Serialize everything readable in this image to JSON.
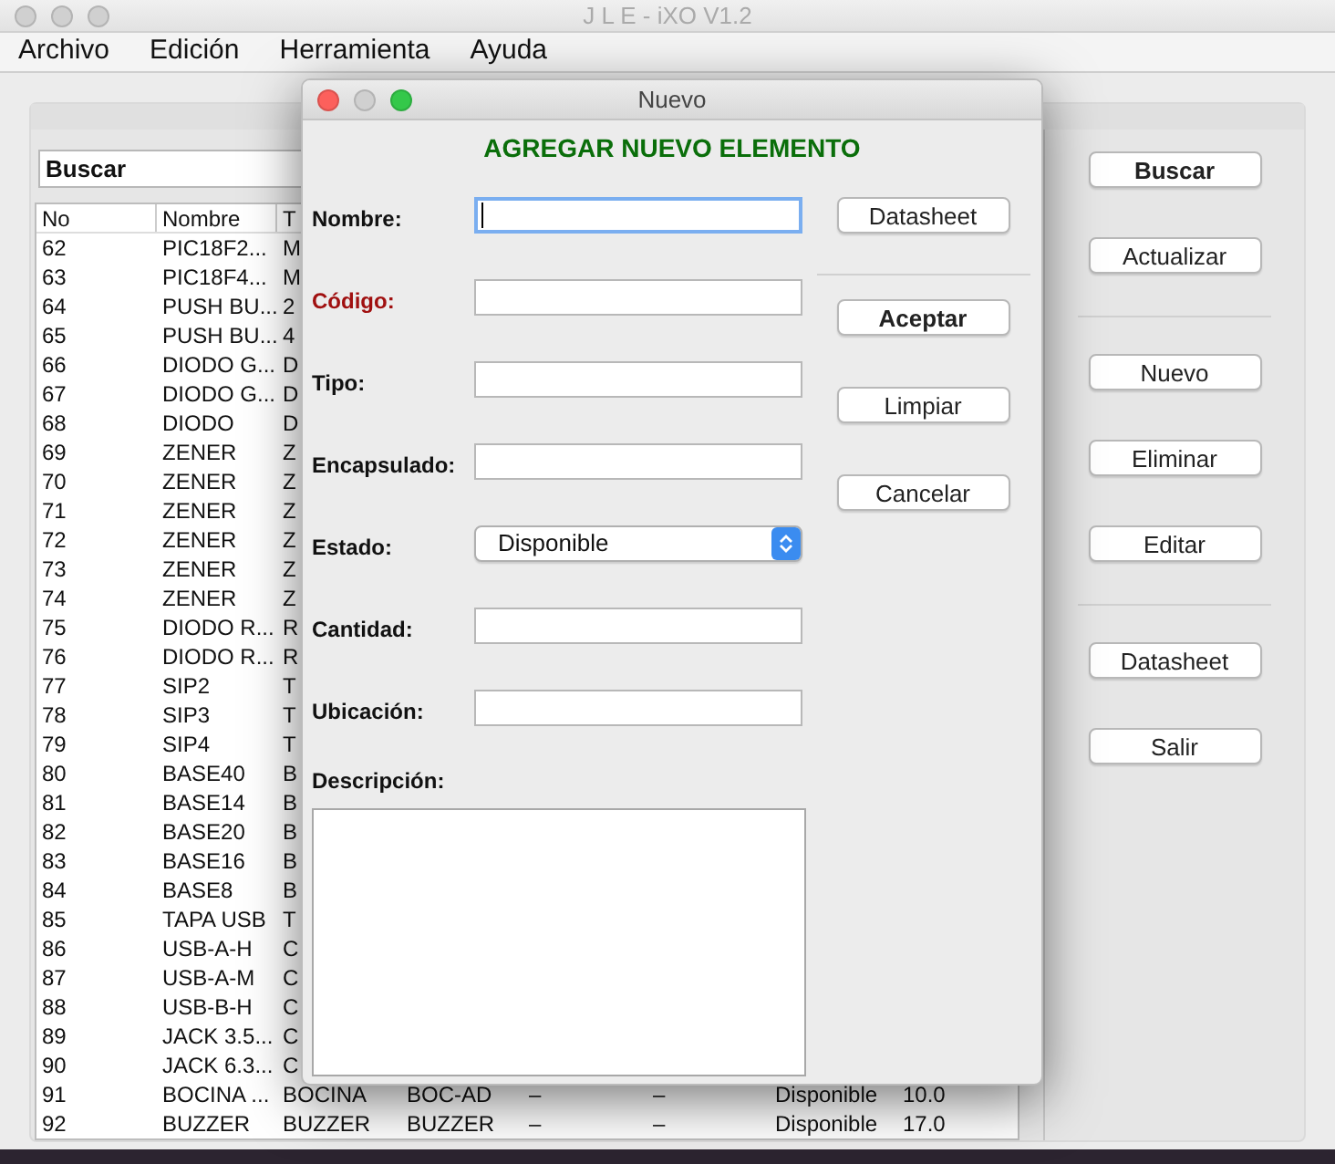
{
  "window": {
    "title": "J L E - iXO V1.2"
  },
  "menu": [
    "Archivo",
    "Edición",
    "Herramienta",
    "Ayuda"
  ],
  "search": {
    "value": "Buscar"
  },
  "table": {
    "columns": [
      "No",
      "Nombre",
      "T"
    ],
    "rows": [
      {
        "cells": [
          "62",
          "PIC18F2...",
          "M"
        ]
      },
      {
        "cells": [
          "63",
          "PIC18F4...",
          "M"
        ]
      },
      {
        "cells": [
          "64",
          "PUSH BU...",
          "2"
        ]
      },
      {
        "cells": [
          "65",
          "PUSH BU...",
          "4"
        ]
      },
      {
        "cells": [
          "66",
          "DIODO G...",
          "D"
        ]
      },
      {
        "cells": [
          "67",
          "DIODO G...",
          "D"
        ]
      },
      {
        "cells": [
          "68",
          "DIODO",
          "D"
        ]
      },
      {
        "cells": [
          "69",
          "ZENER",
          "Z"
        ]
      },
      {
        "cells": [
          "70",
          "ZENER",
          "Z"
        ]
      },
      {
        "cells": [
          "71",
          "ZENER",
          "Z"
        ]
      },
      {
        "cells": [
          "72",
          "ZENER",
          "Z"
        ]
      },
      {
        "cells": [
          "73",
          "ZENER",
          "Z"
        ]
      },
      {
        "cells": [
          "74",
          "ZENER",
          "Z"
        ]
      },
      {
        "cells": [
          "75",
          "DIODO R...",
          "R"
        ]
      },
      {
        "cells": [
          "76",
          "DIODO R...",
          "R"
        ]
      },
      {
        "cells": [
          "77",
          "SIP2",
          "T"
        ]
      },
      {
        "cells": [
          "78",
          "SIP3",
          "T"
        ]
      },
      {
        "cells": [
          "79",
          "SIP4",
          "T"
        ]
      },
      {
        "cells": [
          "80",
          "BASE40",
          "B"
        ]
      },
      {
        "cells": [
          "81",
          "BASE14",
          "B"
        ]
      },
      {
        "cells": [
          "82",
          "BASE20",
          "B"
        ]
      },
      {
        "cells": [
          "83",
          "BASE16",
          "B"
        ]
      },
      {
        "cells": [
          "84",
          "BASE8",
          "B"
        ]
      },
      {
        "cells": [
          "85",
          "TAPA USB",
          "T"
        ]
      },
      {
        "cells": [
          "86",
          "USB-A-H",
          "C"
        ]
      },
      {
        "cells": [
          "87",
          "USB-A-M",
          "C"
        ]
      },
      {
        "cells": [
          "88",
          "USB-B-H",
          "C"
        ]
      },
      {
        "cells": [
          "89",
          "JACK 3.5...",
          "C"
        ]
      },
      {
        "cells": [
          "90",
          "JACK 6.3...",
          "C"
        ]
      },
      {
        "cells": [
          "91",
          "BOCINA ...",
          "BOCINA",
          "BOC-AD",
          "–",
          "–",
          "Disponible",
          "10.0"
        ]
      },
      {
        "cells": [
          "92",
          "BUZZER",
          "BUZZER",
          "BUZZER",
          "–",
          "–",
          "Disponible",
          "17.0"
        ]
      }
    ]
  },
  "side_buttons": [
    [
      {
        "label": "Buscar",
        "default": true
      },
      {
        "label": "Actualizar",
        "default": false
      }
    ],
    [
      {
        "label": "Nuevo",
        "default": false
      },
      {
        "label": "Eliminar",
        "default": false
      },
      {
        "label": "Editar",
        "default": false
      }
    ],
    [
      {
        "label": "Datasheet",
        "default": false
      },
      {
        "label": "Salir",
        "default": false
      }
    ]
  ],
  "dialog": {
    "title": "Nuevo",
    "heading": "AGREGAR NUEVO ELEMENTO",
    "fields": [
      {
        "label": "Nombre:",
        "kind": "text",
        "focused": true,
        "highlighted": false
      },
      {
        "label": "Código:",
        "kind": "text",
        "focused": false,
        "highlighted": true
      },
      {
        "label": "Tipo:",
        "kind": "text",
        "focused": false,
        "highlighted": false
      },
      {
        "label": "Encapsulado:",
        "kind": "text",
        "focused": false,
        "highlighted": false
      },
      {
        "label": "Estado:",
        "kind": "select",
        "value": "Disponible",
        "highlighted": false
      },
      {
        "label": "Cantidad:",
        "kind": "text",
        "focused": false,
        "highlighted": false
      },
      {
        "label": "Ubicación:",
        "kind": "text",
        "focused": false,
        "highlighted": false
      }
    ],
    "description": {
      "label": "Descripción:"
    },
    "buttons": [
      [
        {
          "label": "Datasheet",
          "default": false
        }
      ],
      [
        {
          "label": "Aceptar",
          "default": true
        },
        {
          "label": "Limpiar",
          "default": false
        },
        {
          "label": "Cancelar",
          "default": false
        }
      ]
    ]
  }
}
